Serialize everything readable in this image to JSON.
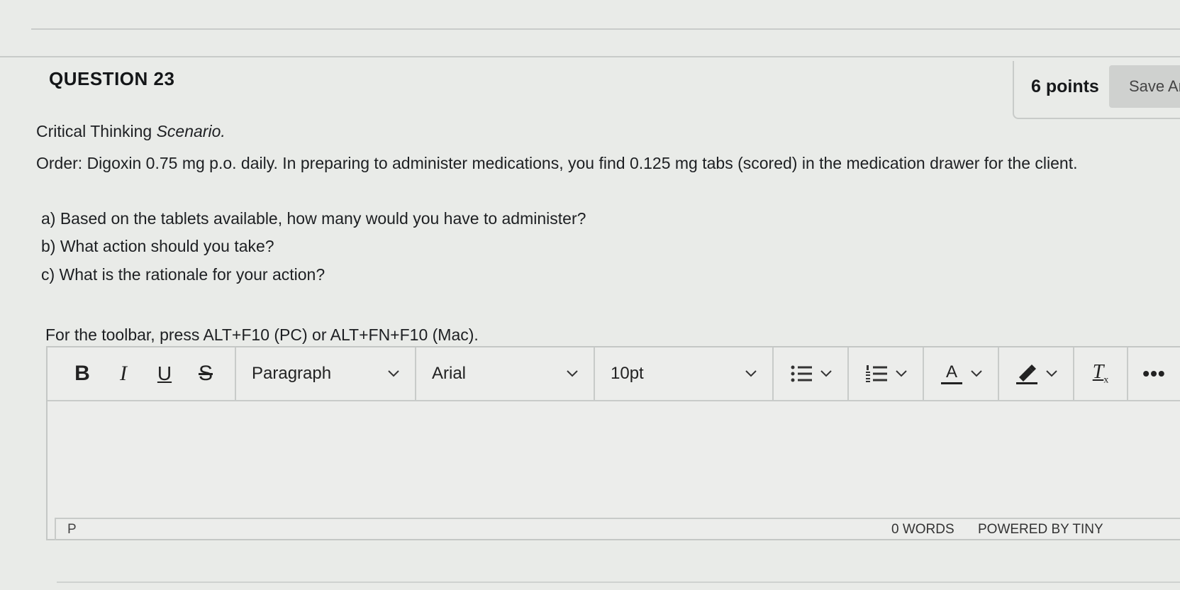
{
  "question": {
    "title": "QUESTION 23",
    "points": "6 points",
    "save_label": "Save An"
  },
  "prompt": {
    "scenario_prefix": "Critical Thinking ",
    "scenario_italic": "Scenario.",
    "order": "Order: Digoxin 0.75 mg p.o. daily. In preparing to administer medications, you find 0.125 mg tabs (scored) in the medication drawer for the client.",
    "items": [
      "a) Based on the tablets available, how many would you have to administer?",
      "b) What action should you take?",
      "c) What is the rationale for your action?"
    ]
  },
  "editor": {
    "toolbar_hint": "For the toolbar, press ALT+F10 (PC) or ALT+FN+F10 (Mac).",
    "bold": "B",
    "italic": "I",
    "underline": "U",
    "strikethrough": "S",
    "block_format": "Paragraph",
    "font_family": "Arial",
    "font_size": "10pt",
    "text_color_glyph": "A",
    "clear_format_glyph": "T",
    "clear_format_sub": "x",
    "more": "•••",
    "path": "P",
    "word_count": "0 WORDS",
    "powered_by": "POWERED BY TINY"
  },
  "icons": [
    "bullet-list-icon",
    "numbered-list-icon",
    "text-color-icon",
    "highlight-icon",
    "clear-formatting-icon",
    "chevron-down-icon",
    "more-icon"
  ]
}
